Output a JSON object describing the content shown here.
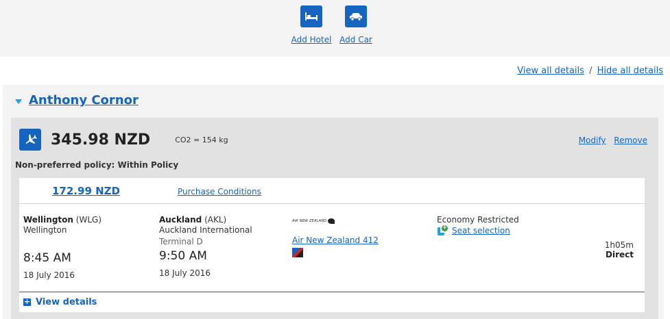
{
  "addons": {
    "hotel": {
      "label": "Add Hotel",
      "icon": "bed-icon"
    },
    "car": {
      "label": "Add Car",
      "icon": "car-icon"
    }
  },
  "details_links": {
    "view_all": "View all details",
    "separator": "/",
    "hide_all": "Hide all details"
  },
  "traveler": {
    "name": "Anthony Cornor"
  },
  "flight": {
    "price": "345.98 NZD",
    "co2": "CO2 = 154 kg",
    "modify": "Modify",
    "remove": "Remove",
    "policy": "Non-preferred policy: Within Policy",
    "fare_price": "172.99 NZD",
    "purchase_conditions": "Purchase Conditions",
    "segment": {
      "departure": {
        "city": "Wellington",
        "code": "(WLG)",
        "airport": "Wellington",
        "time": "8:45 AM",
        "date": "18 July 2016"
      },
      "arrival": {
        "city": "Auckland",
        "code": "(AKL)",
        "airport": "Auckland International",
        "terminal": "Terminal D",
        "time": "9:50 AM",
        "date": "18 July 2016"
      },
      "carrier": {
        "logo_text": "AIR NEW ZEALAND",
        "flight": "Air New Zealand 412"
      },
      "cabin": {
        "class": "Economy Restricted",
        "seat_selection": "Seat selection"
      },
      "duration": "1h05m",
      "stops": "Direct"
    },
    "view_details": "View details"
  },
  "colors": {
    "brand_blue": "#1565c0",
    "accent_cyan": "#1aa3e8",
    "panel_gray": "#e2e2e2"
  }
}
